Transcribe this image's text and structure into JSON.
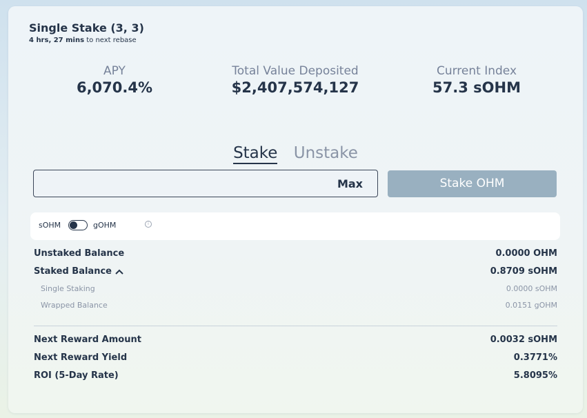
{
  "header": {
    "title": "Single Stake (3, 3)",
    "rebase_time": "4 hrs, 27 mins",
    "rebase_suffix": " to next rebase"
  },
  "metrics": {
    "apy": {
      "label": "APY",
      "value": "6,070.4%"
    },
    "tvd": {
      "label": "Total Value Deposited",
      "value": "$2,407,574,127"
    },
    "index": {
      "label": "Current Index",
      "value": "57.3 sOHM"
    }
  },
  "tabs": {
    "stake": "Stake",
    "unstake": "Unstake",
    "active": "stake"
  },
  "input": {
    "value": "",
    "placeholder": "",
    "max_label": "Max"
  },
  "stake_button": "Stake OHM",
  "toggle": {
    "left_label": "sOHM",
    "right_label": "gOHM",
    "info_glyph": "i",
    "info_icon": "info-icon",
    "state": "sOHM"
  },
  "balances": {
    "unstaked": {
      "label": "Unstaked Balance",
      "value": "0.0000 OHM"
    },
    "staked": {
      "label": "Staked Balance",
      "value": "0.8709 sOHM",
      "expanded": true
    },
    "single_staking": {
      "label": "Single Staking",
      "value": "0.0000 sOHM"
    },
    "wrapped": {
      "label": "Wrapped Balance",
      "value": "0.0151 gOHM"
    }
  },
  "rewards": {
    "next_amount": {
      "label": "Next Reward Amount",
      "value": "0.0032 sOHM"
    },
    "next_yield": {
      "label": "Next Reward Yield",
      "value": "0.3771%"
    },
    "roi": {
      "label": "ROI (5-Day Rate)",
      "value": "5.8095%"
    }
  },
  "colors": {
    "primary_text": "#253449",
    "muted_text": "#768299",
    "button_disabled": "#99b0c0"
  }
}
